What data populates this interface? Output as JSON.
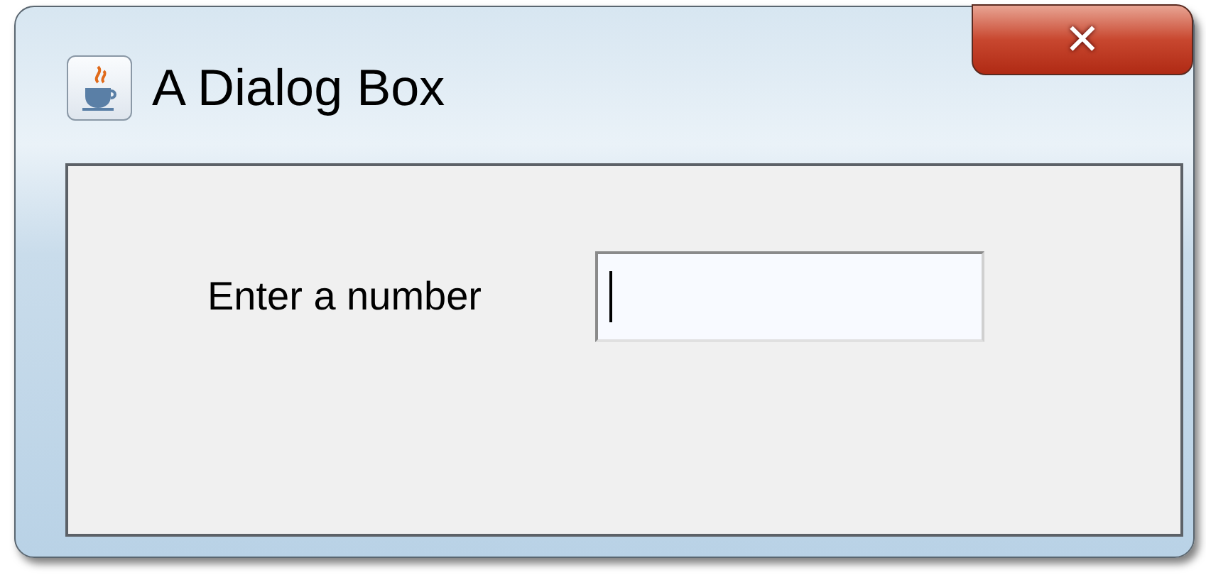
{
  "window": {
    "title": "A Dialog Box",
    "close_glyph": "✕"
  },
  "form": {
    "label": "Enter a number",
    "field": {
      "focused": true
    }
  }
}
